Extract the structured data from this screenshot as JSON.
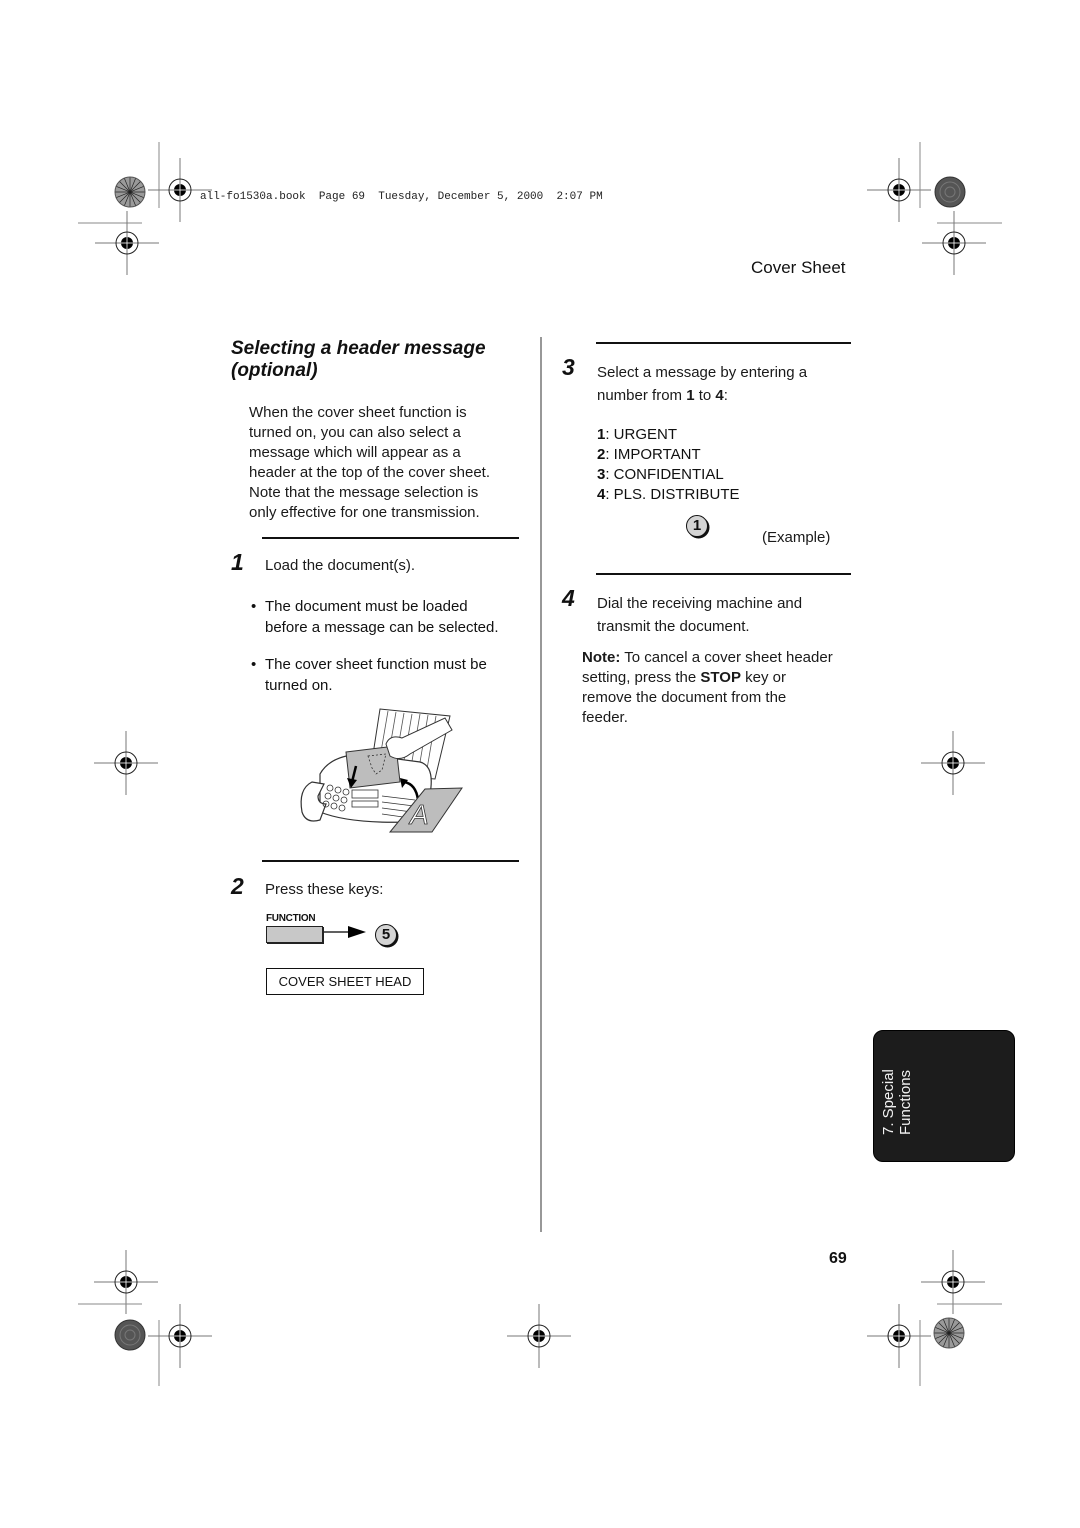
{
  "print_header": {
    "stamp": "all-fo1530a.book  Page 69  Tuesday, December 5, 2000  2:07 PM"
  },
  "section_title": "Cover Sheet",
  "left_column": {
    "heading_line1": "Selecting a header message",
    "heading_line2": "(optional)",
    "intro_lines": [
      "When the cover sheet function is",
      "turned on, you can also select a",
      "message which will appear as a",
      "header at the top of the cover sheet.",
      "Note that the message selection is",
      "only effective for one transmission."
    ],
    "step1": {
      "number": "1",
      "text": "Load the document(s).",
      "bullets": [
        {
          "line1": "The document must be loaded",
          "line2": "before a message can be selected."
        },
        {
          "line1": "The cover sheet function must be",
          "line2": "turned on."
        }
      ],
      "illustration": "fax-machine-loading-document",
      "illustration_letter": "A"
    },
    "step2": {
      "number": "2",
      "text": "Press these keys:",
      "function_key_label": "FUNCTION",
      "number_key": "5",
      "display_text": "COVER SHEET HEAD"
    }
  },
  "right_column": {
    "step3": {
      "number": "3",
      "line1": "Select a message by entering a",
      "line2_prefix": "number from ",
      "line2_from": "1",
      "line2_mid": " to ",
      "line2_to": "4",
      "line2_suffix": ":",
      "messages": [
        {
          "num": "1",
          "label": ": URGENT"
        },
        {
          "num": "2",
          "label": ": IMPORTANT"
        },
        {
          "num": "3",
          "label": ": CONFIDENTIAL"
        },
        {
          "num": "4",
          "label": ": PLS. DISTRIBUTE"
        }
      ],
      "example_key": "1",
      "example_label": "(Example)"
    },
    "step4": {
      "number": "4",
      "line1": "Dial the receiving machine and",
      "line2": "transmit the document."
    },
    "note": {
      "label": "Note:",
      "text1": " To cancel a cover sheet header",
      "text2a": "setting, press the ",
      "key": "STOP",
      "text2b": " key or",
      "text3": "remove the document from the",
      "text4": "feeder."
    }
  },
  "chapter_tab": {
    "line1": "7. Special",
    "line2": "Functions"
  },
  "page_number": "69"
}
